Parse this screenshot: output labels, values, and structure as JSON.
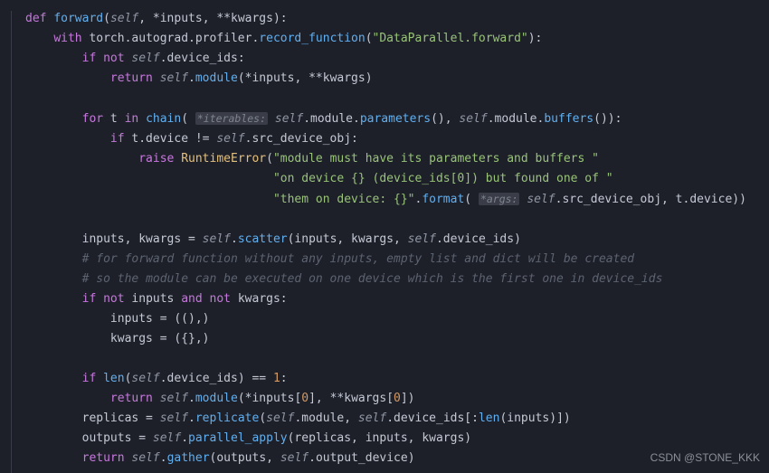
{
  "code": {
    "lines": [
      "def forward(self, *inputs, **kwargs):",
      "    with torch.autograd.profiler.record_function(\"DataParallel.forward\"):",
      "        if not self.device_ids:",
      "            return self.module(*inputs, **kwargs)",
      "",
      "        for t in chain( *iterables: self.module.parameters(), self.module.buffers()):",
      "            if t.device != self.src_device_obj:",
      "                raise RuntimeError(\"module must have its parameters and buffers \"",
      "                                   \"on device {} (device_ids[0]) but found one of \"",
      "                                   \"them on device: {}\".format( *args: self.src_device_obj, t.device))",
      "",
      "        inputs, kwargs = self.scatter(inputs, kwargs, self.device_ids)",
      "        # for forward function without any inputs, empty list and dict will be created",
      "        # so the module can be executed on one device which is the first one in device_ids",
      "        if not inputs and not kwargs:",
      "            inputs = ((),)",
      "            kwargs = ({},)",
      "",
      "        if len(self.device_ids) == 1:",
      "            return self.module(*inputs[0], **kwargs[0])",
      "        replicas = self.replicate(self.module, self.device_ids[:len(inputs)])",
      "        outputs = self.parallel_apply(replicas, inputs, kwargs)",
      "        return self.gather(outputs, self.output_device)"
    ],
    "hints": {
      "iterables": "*iterables:",
      "args": "*args:"
    },
    "strings": {
      "record_fn": "DataParallel.forward",
      "err1": "module must have its parameters and buffers ",
      "err2": "on device {} (device_ids[0]) but found one of ",
      "err3": "them on device: {}"
    },
    "comments": {
      "c1": "# for forward function without any inputs, empty list and dict will be created",
      "c2": "# so the module can be executed on one device which is the first one in device_ids"
    }
  },
  "watermark": "CSDN @STONE_KKK"
}
